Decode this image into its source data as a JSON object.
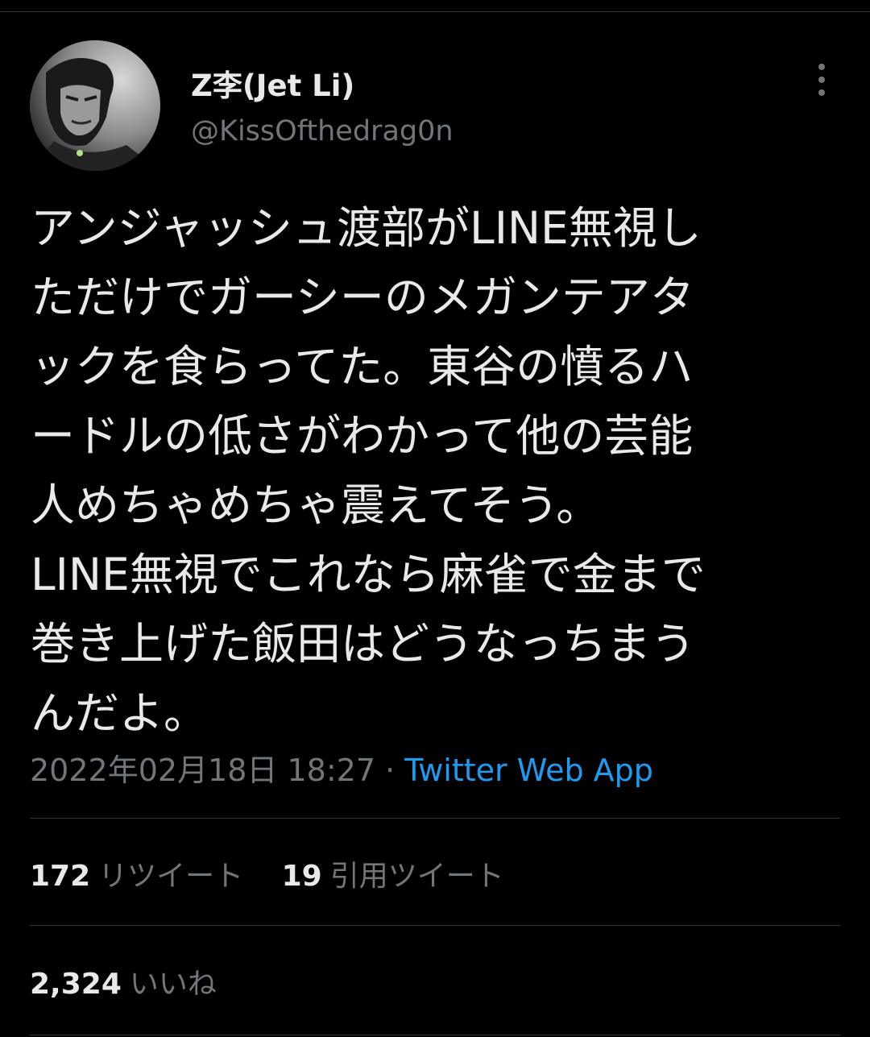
{
  "user": {
    "display_name": "Z李(Jet Li)",
    "handle": "@KissOfthedrag0n"
  },
  "tweet": {
    "lines": [
      "アンジャッシュ渡部がLINE無視し",
      "ただけでガーシーのメガンテアタ",
      "ックを食らってた。東谷の憤るハ",
      "ードルの低さがわかって他の芸能",
      "人めちゃめちゃ震えてそう。",
      "LINE無視でこれなら麻雀で金まで",
      "巻き上げた飯田はどうなっちまう",
      "んだよ。"
    ],
    "timestamp": "2022年02月18日 18:27",
    "separator": "·",
    "source": "Twitter Web App"
  },
  "stats": {
    "retweets_count": "172",
    "retweets_label": "リツイート",
    "quotes_count": "19",
    "quotes_label": "引用ツイート",
    "likes_count": "2,324",
    "likes_label": "いいね"
  },
  "icons": {
    "more": "more-vertical-icon"
  },
  "colors": {
    "background": "#000000",
    "text": "#e7e9ea",
    "secondary": "#71767b",
    "link": "#1d9bf0",
    "divider": "#2f3336"
  }
}
